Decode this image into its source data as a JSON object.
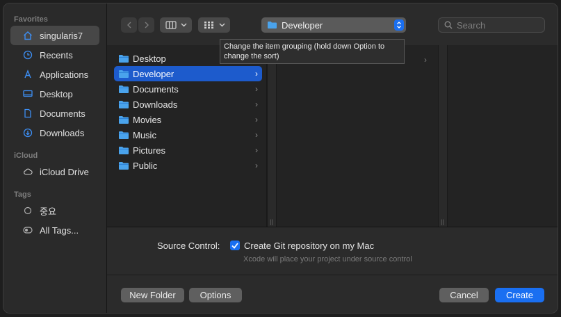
{
  "sidebar": {
    "favorites_label": "Favorites",
    "favorites": [
      {
        "label": "singularis7",
        "icon": "home-icon",
        "selected": true
      },
      {
        "label": "Recents",
        "icon": "clock-icon"
      },
      {
        "label": "Applications",
        "icon": "applications-icon"
      },
      {
        "label": "Desktop",
        "icon": "desktop-icon"
      },
      {
        "label": "Documents",
        "icon": "document-icon"
      },
      {
        "label": "Downloads",
        "icon": "download-icon"
      }
    ],
    "icloud_label": "iCloud",
    "icloud": [
      {
        "label": "iCloud Drive",
        "icon": "cloud-icon"
      }
    ],
    "tags_label": "Tags",
    "tags": [
      {
        "label": "중요",
        "icon": "tag-circle-icon"
      },
      {
        "label": "All Tags...",
        "icon": "all-tags-icon"
      }
    ]
  },
  "toolbar": {
    "path_label": "Developer",
    "search_placeholder": "Search"
  },
  "tooltip": {
    "text": "Change the item grouping (hold down Option to change the sort)"
  },
  "column1": [
    {
      "label": "Desktop",
      "selected": false
    },
    {
      "label": "Developer",
      "selected": true
    },
    {
      "label": "Documents",
      "selected": false
    },
    {
      "label": "Downloads",
      "selected": false
    },
    {
      "label": "Movies",
      "selected": false
    },
    {
      "label": "Music",
      "selected": false
    },
    {
      "label": "Pictures",
      "selected": false
    },
    {
      "label": "Public",
      "selected": false
    }
  ],
  "options": {
    "source_control_label": "Source Control:",
    "git_checkbox_label": "Create Git repository on my Mac",
    "git_checked": true,
    "hint": "Xcode will place your project under source control"
  },
  "buttons": {
    "new_folder": "New Folder",
    "options": "Options",
    "cancel": "Cancel",
    "create": "Create"
  },
  "colors": {
    "accent": "#1a6ff1",
    "selection": "#1d5bcc",
    "folder": "#4aa3ec"
  }
}
